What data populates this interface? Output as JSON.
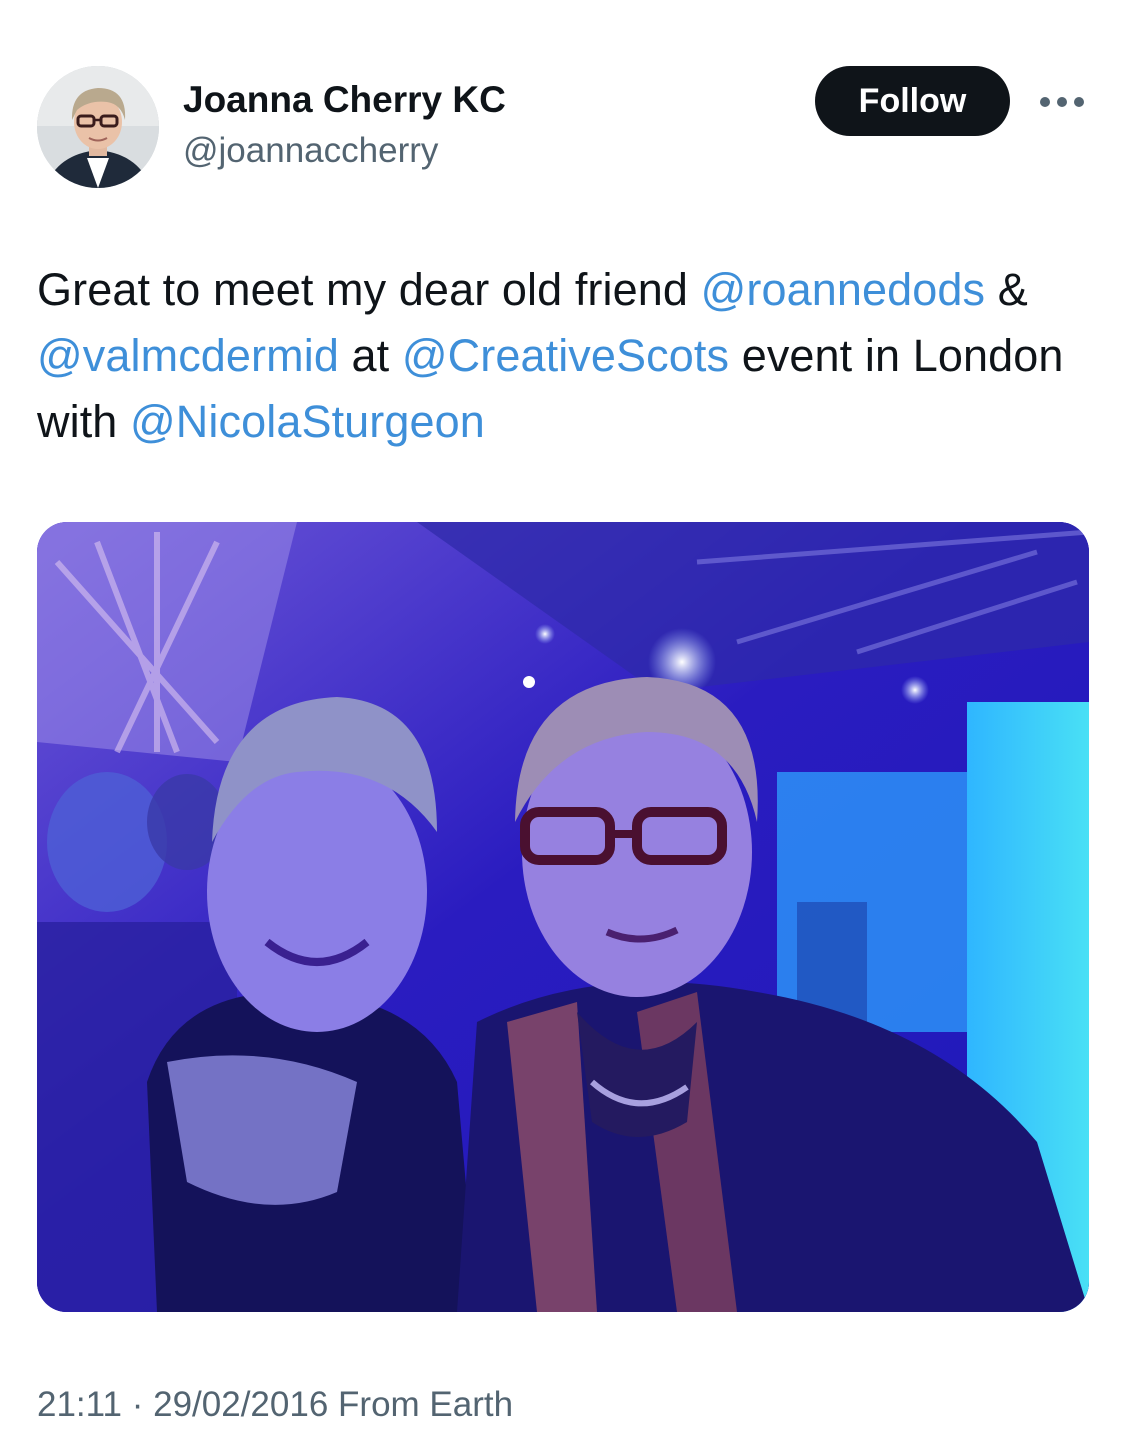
{
  "author": {
    "name": "Joanna Cherry KC",
    "handle": "@joannaccherry",
    "avatar_icon": "profile-photo"
  },
  "actions": {
    "follow_label": "Follow",
    "more_icon": "more-dots-icon"
  },
  "tweet": {
    "segments": [
      {
        "type": "text",
        "value": "Great to meet my dear old friend "
      },
      {
        "type": "mention",
        "value": "@roannedods"
      },
      {
        "type": "text",
        "value": " & "
      },
      {
        "type": "mention",
        "value": "@valmcdermid"
      },
      {
        "type": "text",
        "value": " at "
      },
      {
        "type": "mention",
        "value": "@CreativeScots"
      },
      {
        "type": "text",
        "value": " event in London with "
      },
      {
        "type": "mention",
        "value": "@NicolaSturgeon"
      }
    ]
  },
  "media": {
    "kind": "photo",
    "alt_icon": "event-photo"
  },
  "meta": {
    "time": "21:11",
    "separator": "·",
    "date": "29/02/2016",
    "source": "From Earth"
  },
  "colors": {
    "mention": "#3e8fd9",
    "follow_bg": "#0f1419",
    "secondary_text": "#536471"
  }
}
